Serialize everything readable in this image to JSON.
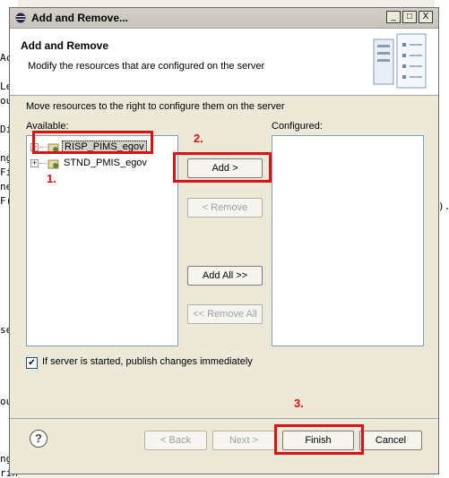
{
  "background": {
    "left_strip_lines": [
      "Ac",
      "",
      "Lea",
      "oug",
      "",
      "Di",
      "",
      "ng",
      "Fil",
      "ne",
      "F(",
      "",
      "",
      "",
      "",
      "",
      "",
      "",
      "",
      "se",
      "",
      "",
      "",
      "",
      "oug",
      "",
      "",
      "",
      "ng",
      "rin"
    ],
    "right_glyph": ")."
  },
  "dialog": {
    "title": "Add and Remove...",
    "window_buttons": {
      "minimize": "_",
      "maximize": "□",
      "close": "X"
    },
    "header": {
      "title": "Add and Remove",
      "description": "Modify the resources that are configured on the server"
    },
    "instruction": "Move resources to the right to configure them on the server",
    "available_label": "Available:",
    "configured_label": "Configured:",
    "available_items": [
      {
        "label": "RISP_PIMS_egov",
        "selected": true,
        "expander": "+"
      },
      {
        "label": "STND_PMIS_egov",
        "selected": false,
        "expander": "+"
      }
    ],
    "configured_items": [],
    "buttons": {
      "add": "Add >",
      "remove": "< Remove",
      "add_all": "Add All >>",
      "remove_all": "<< Remove All",
      "back": "< Back",
      "next": "Next >",
      "finish": "Finish",
      "cancel": "Cancel"
    },
    "checkbox": {
      "label": "If server is started, publish changes immediately",
      "checked": true,
      "mark": "✔"
    },
    "help_icon": "?"
  },
  "annotations": [
    "1.",
    "2.",
    "3."
  ],
  "colors": {
    "annotation": "#e01010",
    "list_border": "#7f9db9",
    "dialog_bg": "#ece9d8"
  }
}
